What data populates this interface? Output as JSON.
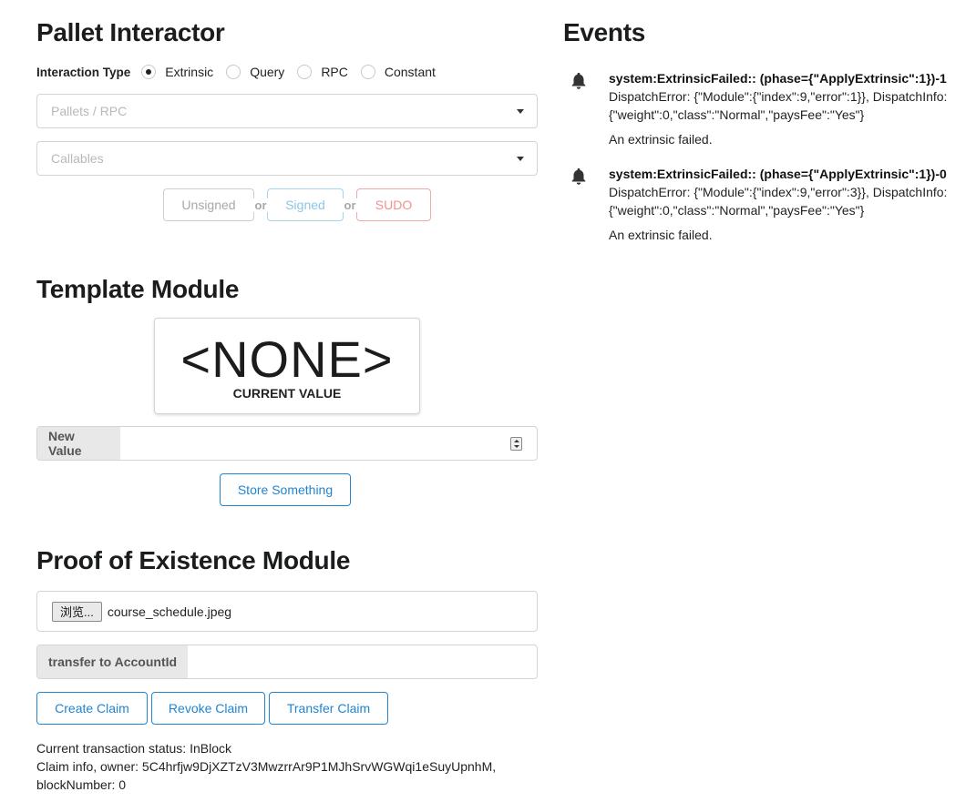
{
  "pallet_interactor": {
    "title": "Pallet Interactor",
    "interaction_type_label": "Interaction Type",
    "options": [
      "Extrinsic",
      "Query",
      "RPC",
      "Constant"
    ],
    "selected": "Extrinsic",
    "pallets_placeholder": "Pallets / RPC",
    "callables_placeholder": "Callables",
    "unsigned_label": "Unsigned",
    "or_label": "or",
    "signed_label": "Signed",
    "sudo_label": "SUDO"
  },
  "template_module": {
    "title": "Template Module",
    "current_value": "<NONE>",
    "current_value_caption": "CURRENT VALUE",
    "new_value_label": "New Value",
    "store_button": "Store Something"
  },
  "poe_module": {
    "title": "Proof of Existence Module",
    "browse_label": "浏览...",
    "file_name": "course_schedule.jpeg",
    "transfer_label": "transfer to AccountId",
    "create_claim": "Create Claim",
    "revoke_claim": "Revoke Claim",
    "transfer_claim": "Transfer Claim",
    "status_line": "Current transaction status: InBlock",
    "claim_info": "Claim info, owner: 5C4hrfjw9DjXZTzV3MwzrrAr9P1MJhSrvWGWqi1eSuyUpnhM, blockNumber: 0"
  },
  "events": {
    "title": "Events",
    "items": [
      {
        "title": "system:ExtrinsicFailed:: (phase={\"ApplyExtrinsic\":1})-1",
        "detail": "DispatchError: {\"Module\":{\"index\":9,\"error\":1}}, DispatchInfo: {\"weight\":0,\"class\":\"Normal\",\"paysFee\":\"Yes\"}",
        "description": "An extrinsic failed."
      },
      {
        "title": "system:ExtrinsicFailed:: (phase={\"ApplyExtrinsic\":1})-0",
        "detail": "DispatchError: {\"Module\":{\"index\":9,\"error\":3}}, DispatchInfo: {\"weight\":0,\"class\":\"Normal\",\"paysFee\":\"Yes\"}",
        "description": "An extrinsic failed."
      }
    ]
  },
  "colors": {
    "primary_blue": "#2185d0",
    "signed_blue": "#8cc5e8",
    "sudo_red": "#f0908f",
    "label_bg": "#e8e8e8"
  }
}
